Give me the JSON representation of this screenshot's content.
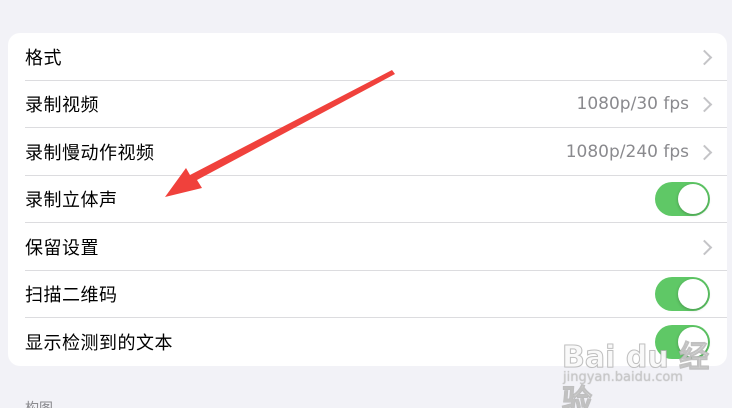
{
  "settings": {
    "rows": [
      {
        "label": "格式",
        "value": "",
        "control": "chevron"
      },
      {
        "label": "录制视频",
        "value": "1080p/30 fps",
        "control": "chevron"
      },
      {
        "label": "录制慢动作视频",
        "value": "1080p/240 fps",
        "control": "chevron"
      },
      {
        "label": "录制立体声",
        "value": "",
        "control": "toggle",
        "on": true
      },
      {
        "label": "保留设置",
        "value": "",
        "control": "chevron"
      },
      {
        "label": "扫描二维码",
        "value": "",
        "control": "toggle",
        "on": true
      },
      {
        "label": "显示检测到的文本",
        "value": "",
        "control": "toggle",
        "on": true
      }
    ],
    "next_section_header": "构图"
  },
  "watermark": {
    "brand": "Bai du 经验",
    "url": "jingyan.baidu.com"
  },
  "colors": {
    "background": "#f2f2f7",
    "card": "#ffffff",
    "toggle_on": "#5fc866",
    "secondary_text": "#8a8a8e",
    "annotation_arrow": "#f0413c"
  },
  "annotation": {
    "icon": "red-pointer-arrow-icon"
  }
}
